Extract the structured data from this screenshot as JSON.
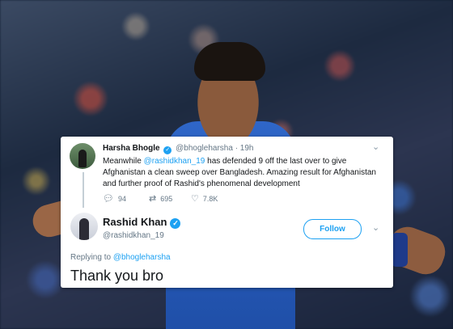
{
  "tweet1": {
    "name": "Harsha Bhogle",
    "handle": "@bhogleharsha",
    "time": "· 19h",
    "text_before": "Meanwhile ",
    "mention": "@rashidkhan_19",
    "text_after": " has defended 9 off the last over to give Afghanistan a clean sweep over Bangladesh. Amazing result for Afghanistan and further proof of Rashid's phenomenal development",
    "replies": "94",
    "retweets": "695",
    "likes": "7.8K"
  },
  "tweet2": {
    "name": "Rashid Khan",
    "handle": "@rashidkhan_19",
    "follow_label": "Follow",
    "replying_prefix": "Replying to ",
    "replying_to": "@bhogleharsha",
    "text": "Thank you bro"
  },
  "icons": {
    "reply": "reply-icon",
    "retweet": "retweet-icon",
    "like": "heart-icon",
    "verified": "verified-badge-icon",
    "more": "chevron-down-icon"
  },
  "colors": {
    "twitter_blue": "#1da1f2",
    "muted": "#657786",
    "text": "#14171a"
  }
}
